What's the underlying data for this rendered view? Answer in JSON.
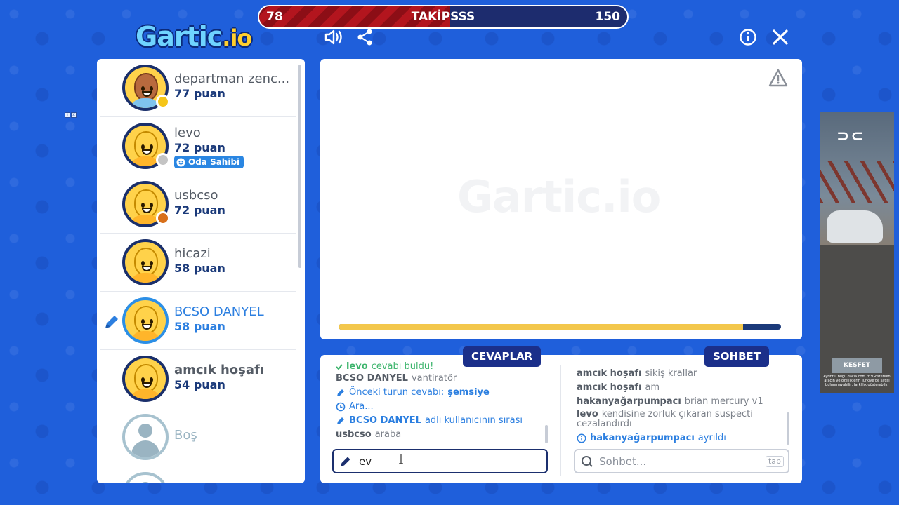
{
  "scorebar": {
    "left": "78",
    "title": "TAKİPSSS",
    "right": "150"
  },
  "logo": {
    "main": "Gartic",
    "suffix": ".io"
  },
  "players": [
    {
      "name": "departman zenc...",
      "points": "77 puan",
      "avatar": "dark",
      "dot_color": "#f5c518"
    },
    {
      "name": "levo",
      "points": "72 puan",
      "avatar": "yellow",
      "dot_color": "#c4c4c4",
      "badge": "Oda Sahibi"
    },
    {
      "name": "usbcso",
      "points": "72 puan",
      "avatar": "yellow",
      "dot_color": "#d8701a"
    },
    {
      "name": "hicazi",
      "points": "58 puan",
      "avatar": "yellow"
    },
    {
      "name": "BCSO DANYEL",
      "points": "58 puan",
      "avatar": "yellow",
      "drawing": true
    },
    {
      "name": "amcık hoşafı",
      "points": "54 puan",
      "avatar": "yellow"
    },
    {
      "name": "Boş",
      "avatar": "empty"
    }
  ],
  "canvas": {
    "watermark": "Gartic.io",
    "timer_fraction": 0.915
  },
  "answers": {
    "title": "CEVAPLAR",
    "messages": [
      {
        "user": "levo",
        "text": "cevabı buldu!"
      },
      {
        "user": "BCSO DANYEL",
        "text": "vantiratör"
      },
      {
        "text": "Önceki turun cevabı:",
        "answer": "şemsiye"
      },
      {
        "text": "Ara..."
      },
      {
        "user": "BCSO DANYEL",
        "text": "adlı kullanıcının sırası"
      },
      {
        "user": "usbcso",
        "text": "araba"
      }
    ],
    "input_value": "ev"
  },
  "chat": {
    "title": "SOHBET",
    "messages": [
      {
        "user": "amcık hoşafı",
        "text": "sikiş krallar"
      },
      {
        "user": "amcık hoşafı",
        "text": "am"
      },
      {
        "user": "hakanyağarpumpacı",
        "text": "brian mercury v1"
      },
      {
        "user": "levo",
        "text": "kendisine zorluk çıkaran suspecti",
        "text2": "cezalandırdı"
      },
      {
        "user": "hakanyağarpumpacı",
        "text": "ayrıldı"
      }
    ],
    "placeholder": "Sohbet...",
    "tab_hint": "tab"
  },
  "ad": {
    "cta": "KEŞFET",
    "fine": "Ayrıntılı Bilgi: dacia.com.tr *Gösterilen aracın ve özelliklerin Türkiye'de satışı bulunmayabilir; farklılık gösterebilir."
  },
  "colors": {
    "background": "#1f5fdb",
    "navy": "#1b2f8a",
    "accent": "#2c7fe0",
    "timer": "#f3c74c"
  }
}
